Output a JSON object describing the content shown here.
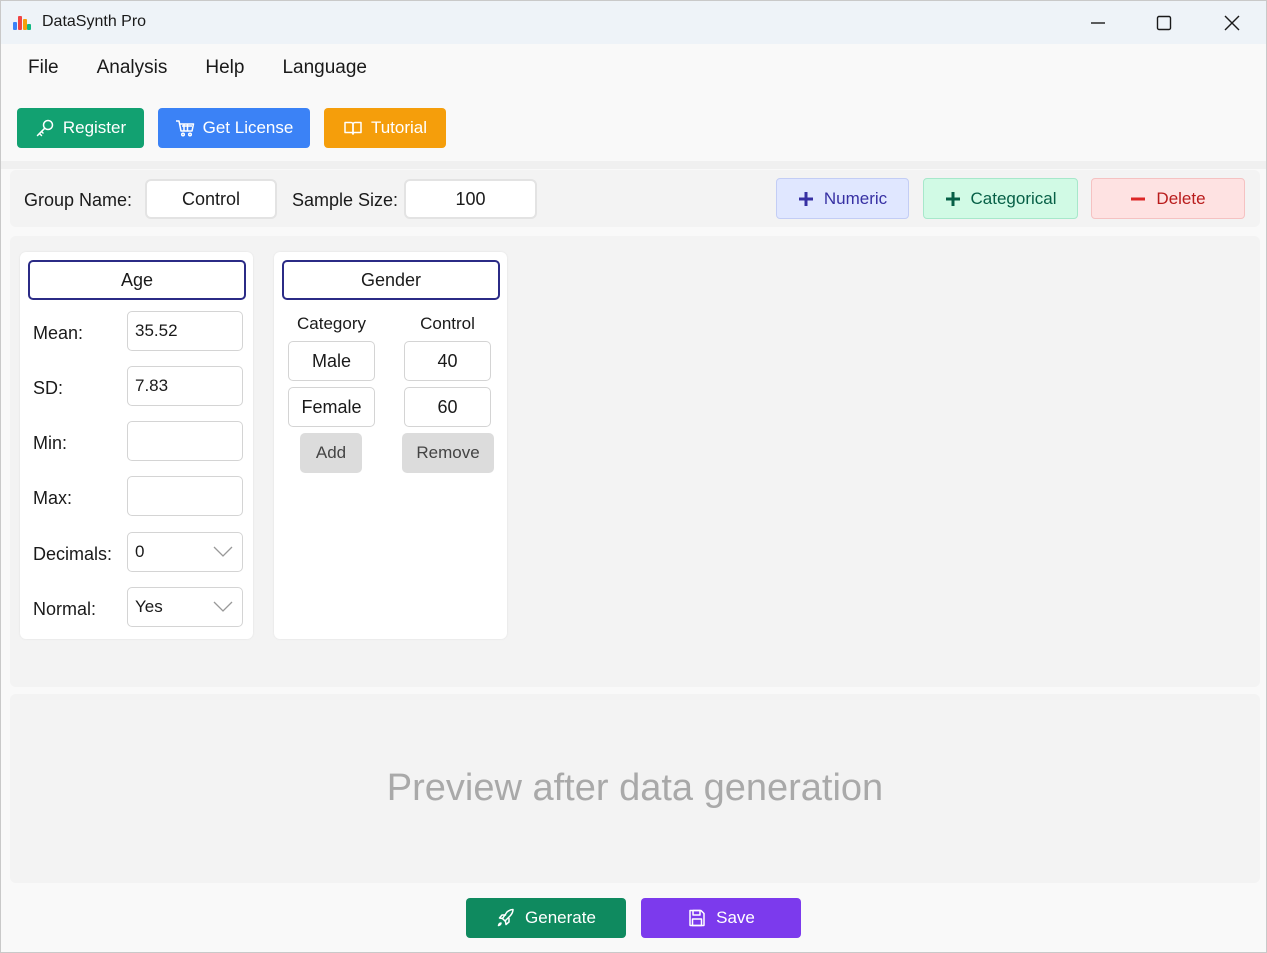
{
  "window": {
    "title": "DataSynth Pro",
    "app_icon": "bar-chart-icon",
    "controls": [
      "minimize-icon",
      "maximize-icon",
      "close-icon"
    ]
  },
  "menu": {
    "items": [
      "File",
      "Analysis",
      "Help",
      "Language"
    ]
  },
  "toolbar": {
    "register_label": "Register",
    "register_icon": "key-icon",
    "license_label": "Get License",
    "license_icon": "cart-icon",
    "tutorial_label": "Tutorial",
    "tutorial_icon": "book-icon",
    "colors": {
      "register": "#0f9d6e",
      "license": "#3b82f6",
      "tutorial": "#f59e0b"
    }
  },
  "group": {
    "name_label": "Group Name:",
    "name_value": "Control",
    "size_label": "Sample Size:",
    "size_value": "100",
    "numeric_label": "Numeric",
    "categorical_label": "Categorical",
    "delete_label": "Delete"
  },
  "numeric_var": {
    "title": "Age",
    "mean_label": "Mean:",
    "mean_value": "35.52",
    "sd_label": "SD:",
    "sd_value": "7.83",
    "min_label": "Min:",
    "min_value": "",
    "max_label": "Max:",
    "max_value": "",
    "decimals_label": "Decimals:",
    "decimals_value": "0",
    "normal_label": "Normal:",
    "normal_value": "Yes"
  },
  "categorical_var": {
    "title": "Gender",
    "col_category": "Category",
    "col_group": "Control",
    "rows": [
      {
        "category": "Male",
        "value": "40"
      },
      {
        "category": "Female",
        "value": "60"
      }
    ],
    "add_label": "Add",
    "remove_label": "Remove"
  },
  "preview": {
    "placeholder": "Preview after data generation"
  },
  "footer": {
    "generate_label": "Generate",
    "generate_icon": "rocket-icon",
    "save_label": "Save",
    "save_icon": "floppy-icon",
    "colors": {
      "generate": "#0f8a5f",
      "save": "#7c3aed"
    }
  }
}
